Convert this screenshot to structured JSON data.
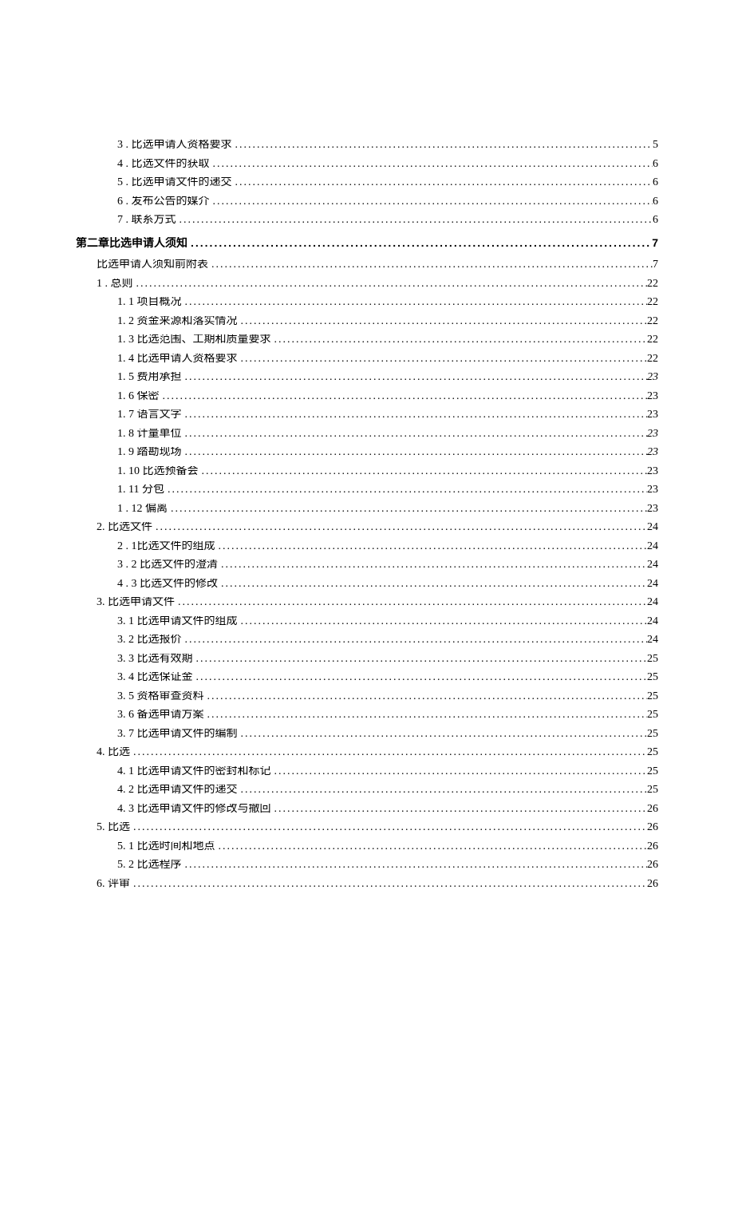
{
  "toc": [
    {
      "indent": "lvl2",
      "num": "3",
      "sep": "  . ",
      "label": "比选申请人资格要求",
      "page": "5"
    },
    {
      "indent": "lvl2",
      "num": "4",
      "sep": "  . ",
      "label": "比选文件的获取",
      "page": "6"
    },
    {
      "indent": "lvl2",
      "num": "5",
      "sep": "  . ",
      "label": "比选申请文件的递交",
      "page": "6"
    },
    {
      "indent": "lvl2",
      "num": "6",
      "sep": "  . ",
      "label": "发布公告的媒介",
      "page": "6"
    },
    {
      "indent": "lvl2",
      "num": "7",
      "sep": "  . ",
      "label": "联系方式",
      "page": "6"
    },
    {
      "section": true,
      "indent": "lvl0",
      "bold": true,
      "num": "",
      "sep": "",
      "label": "第二章比选申请人须知",
      "page": "7"
    },
    {
      "gap": true,
      "indent": "lvl1",
      "num": "",
      "sep": "",
      "label": "比选申请人须知前附表",
      "page": "7"
    },
    {
      "indent": "lvl1",
      "num": "1",
      "sep": "  . ",
      "label": "总则",
      "page": "22"
    },
    {
      "indent": "lvl2",
      "num": "1. 1",
      "sep": "   ",
      "label": "项目概况",
      "page": "22"
    },
    {
      "indent": "lvl2",
      "num": "1. 2",
      "sep": "   ",
      "label": "资金来源和落实情况",
      "page": "22"
    },
    {
      "indent": "lvl2",
      "num": "1. 3",
      "sep": "   ",
      "label": "比选范围、工期和质量要求",
      "page": "22"
    },
    {
      "indent": "lvl2",
      "num": "1. 4",
      "sep": "   ",
      "label": "比选申请人资格要求",
      "page": "22"
    },
    {
      "indent": "lvl2",
      "num": "1. 5",
      "sep": "   ",
      "label": "费用承担",
      "page": "23",
      "italic": true
    },
    {
      "indent": "lvl2",
      "num": "1. 6",
      "sep": "   ",
      "label": "保密",
      "page": "23"
    },
    {
      "indent": "lvl2",
      "num": "1. 7",
      "sep": "   ",
      "label": "语言文字",
      "page": "23"
    },
    {
      "indent": "lvl2",
      "num": "1. 8",
      "sep": "   ",
      "label": "计量单位",
      "page": "23",
      "italic": true
    },
    {
      "indent": "lvl2",
      "num": "1. 9",
      "sep": "   ",
      "label": "踏勘现场",
      "page": "23",
      "italic": true
    },
    {
      "indent": "lvl2",
      "num": "1. 10",
      "sep": "  ",
      "label": "比选预备会",
      "page": "23"
    },
    {
      "indent": "lvl2",
      "num": "1. 11",
      "sep": "  ",
      "label": "分包",
      "page": "23"
    },
    {
      "indent": "lvl2",
      "num": "1",
      "sep": "  . ",
      "label": "12 偏离",
      "page": "23"
    },
    {
      "indent": "lvl1",
      "num": "2.",
      "sep": " ",
      "label": "比选文件",
      "page": "24"
    },
    {
      "indent": "lvl2",
      "num": "2",
      "sep": "  . ",
      "label": "1比选文件的组成",
      "page": "24"
    },
    {
      "indent": "lvl2",
      "num": "3",
      "sep": "  . ",
      "label": "2 比选文件的澄清",
      "page": "24"
    },
    {
      "indent": "lvl2",
      "num": "4",
      "sep": "  . ",
      "label": "3 比选文件的修改",
      "page": "24"
    },
    {
      "indent": "lvl1",
      "num": "3.",
      "sep": " ",
      "label": "比选申请文件",
      "page": "24"
    },
    {
      "indent": "lvl2",
      "num": "3. 1",
      "sep": "   ",
      "label": "比选申请文件的组成",
      "page": "24"
    },
    {
      "indent": "lvl2",
      "num": "3. 2",
      "sep": "   ",
      "label": "比选报价",
      "page": "24"
    },
    {
      "indent": "lvl2",
      "num": "3. 3",
      "sep": "   ",
      "label": "比选有效期",
      "page": "25"
    },
    {
      "indent": "lvl2",
      "num": "3.",
      "sep": "   ",
      "label": "4 比选保证金",
      "page": "25",
      "italicNum": true
    },
    {
      "indent": "lvl2",
      "num": "3. 5",
      "sep": "   ",
      "label": "资格审查资料",
      "page": "25"
    },
    {
      "indent": "lvl2",
      "num": "3. 6",
      "sep": "   ",
      "label": "备选申请方案",
      "page": "25"
    },
    {
      "indent": "lvl2",
      "num": "3. 7",
      "sep": "   ",
      "label": "比选申请文件的编制",
      "page": "25"
    },
    {
      "indent": "lvl1",
      "num": "4.",
      "sep": "  ",
      "label": "比选",
      "page": "25"
    },
    {
      "indent": "lvl2",
      "num": "4. 1",
      "sep": "   ",
      "label": "比选申请文件的密封和标记",
      "page": "25"
    },
    {
      "indent": "lvl2",
      "num": "4. 2",
      "sep": "   ",
      "label": "比选申请文件的递交",
      "page": "25"
    },
    {
      "indent": "lvl2",
      "num": "4.",
      "sep": "  ",
      "label": "3 比选申请文件的修改与撤回",
      "page": "26"
    },
    {
      "indent": "lvl1",
      "num": "5.",
      "sep": "  ",
      "label": "比选",
      "page": "26"
    },
    {
      "indent": "lvl2",
      "num": "5. 1",
      "sep": "   ",
      "label": "比选时间和地点",
      "page": "26"
    },
    {
      "indent": "lvl2",
      "num": "5.",
      "sep": "  ",
      "label": "2 比选程序",
      "page": "26"
    },
    {
      "indent": "lvl1",
      "num": "6.",
      "sep": "  ",
      "label": "评审",
      "page": "26"
    }
  ]
}
